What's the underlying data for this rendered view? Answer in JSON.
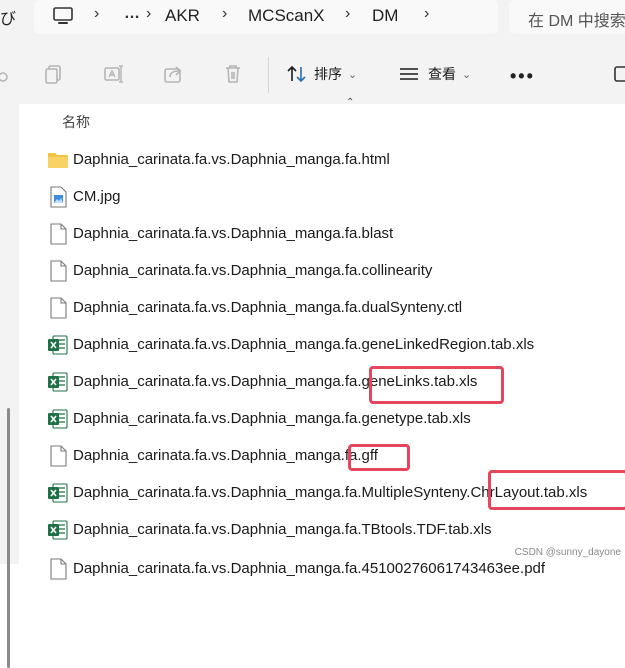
{
  "address_bar": {
    "left_glyph": "び",
    "breadcrumbs": [
      "AKR",
      "MCScanX",
      "DM"
    ],
    "search_placeholder": "在 DM 中搜索"
  },
  "toolbar": {
    "sort_label": "排序",
    "view_label": "查看",
    "more_label": "•••"
  },
  "file_list": {
    "column_name": "名称",
    "files": [
      {
        "name": "Daphnia_carinata.fa.vs.Daphnia_manga.fa.html",
        "icon": "folder-icon"
      },
      {
        "name": "CM.jpg",
        "icon": "image-file-icon"
      },
      {
        "name": "Daphnia_carinata.fa.vs.Daphnia_manga.fa.blast",
        "icon": "file-icon"
      },
      {
        "name": "Daphnia_carinata.fa.vs.Daphnia_manga.fa.collinearity",
        "icon": "file-icon"
      },
      {
        "name": "Daphnia_carinata.fa.vs.Daphnia_manga.fa.dualSynteny.ctl",
        "icon": "file-icon"
      },
      {
        "name": "Daphnia_carinata.fa.vs.Daphnia_manga.fa.geneLinkedRegion.tab.xls",
        "icon": "excel-file-icon"
      },
      {
        "name": "Daphnia_carinata.fa.vs.Daphnia_manga.fa.geneLinks.tab.xls",
        "icon": "excel-file-icon"
      },
      {
        "name": "Daphnia_carinata.fa.vs.Daphnia_manga.fa.genetype.tab.xls",
        "icon": "excel-file-icon"
      },
      {
        "name": "Daphnia_carinata.fa.vs.Daphnia_manga.fa.gff",
        "icon": "file-icon"
      },
      {
        "name": "Daphnia_carinata.fa.vs.Daphnia_manga.fa.MultipleSynteny.ChrLayout.tab.xls",
        "icon": "excel-file-icon"
      },
      {
        "name": "Daphnia_carinata.fa.vs.Daphnia_manga.fa.TBtools.TDF.tab.xls",
        "icon": "excel-file-icon"
      },
      {
        "name": "Daphnia_carinata.fa.vs.Daphnia_manga.fa.45100276061743463ee.pdf",
        "icon": "file-icon"
      }
    ]
  },
  "colors": {
    "highlight": "#e5465d",
    "folder": "#f5c342",
    "excel": "#1e7145"
  },
  "watermark": "CSDN @sunny_dayone"
}
